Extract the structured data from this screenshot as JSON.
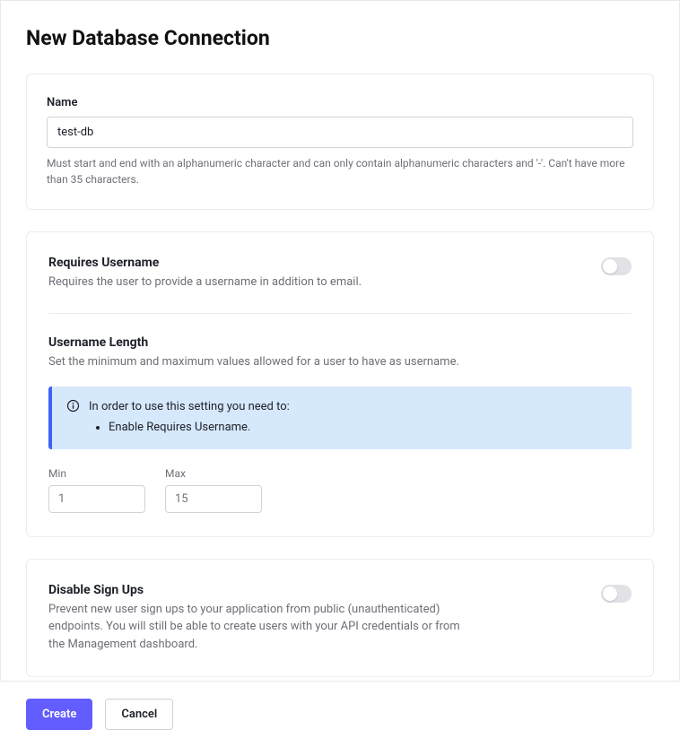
{
  "page": {
    "title": "New Database Connection"
  },
  "name_field": {
    "label": "Name",
    "value": "test-db",
    "help": "Must start and end with an alphanumeric character and can only contain alphanumeric characters and '-'. Can't have more than 35 characters."
  },
  "requires_username": {
    "title": "Requires Username",
    "desc": "Requires the user to provide a username in addition to email.",
    "enabled": false
  },
  "username_length": {
    "title": "Username Length",
    "desc": "Set the minimum and maximum values allowed for a user to have as username.",
    "banner": {
      "intro": "In order to use this setting you need to:",
      "items": [
        "Enable Requires Username."
      ]
    },
    "min_label": "Min",
    "min_placeholder": "1",
    "max_label": "Max",
    "max_placeholder": "15"
  },
  "disable_signups": {
    "title": "Disable Sign Ups",
    "desc": "Prevent new user sign ups to your application from public (unauthenticated) endpoints. You will still be able to create users with your API credentials or from the Management dashboard.",
    "enabled": false
  },
  "buttons": {
    "create": "Create",
    "cancel": "Cancel"
  }
}
